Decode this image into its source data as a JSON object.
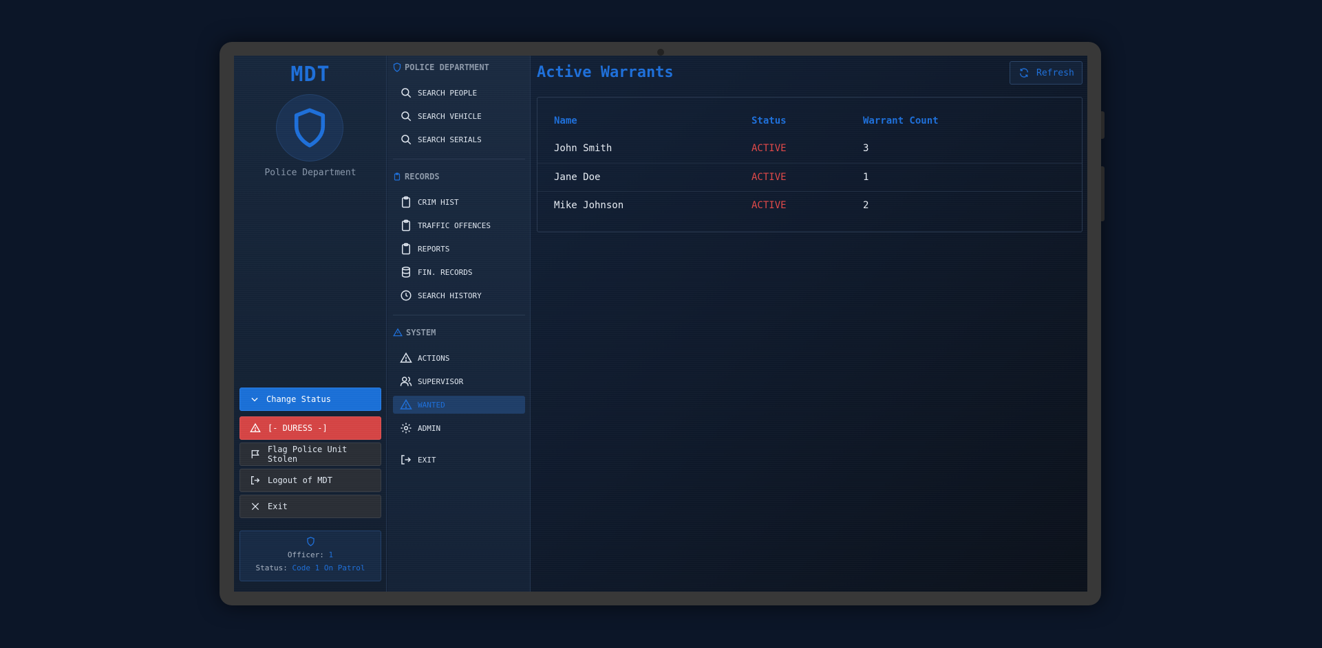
{
  "left_panel": {
    "app_title": "MDT",
    "department_name": "Police Department",
    "buttons": {
      "change_status": "Change Status",
      "duress": "[- DURESS -]",
      "flag_stolen": "Flag Police Unit Stolen",
      "logout": "Logout of MDT",
      "exit": "Exit"
    },
    "officer": {
      "officer_label": "Officer:",
      "officer_value": "1",
      "status_label": "Status:",
      "status_value": "Code 1 On Patrol"
    }
  },
  "nav": {
    "sections": [
      {
        "title": "POLICE DEPARTMENT",
        "icon": "shield-icon"
      },
      {
        "title": "RECORDS",
        "icon": "clipboard-icon"
      },
      {
        "title": "SYSTEM",
        "icon": "warning-icon"
      }
    ],
    "items": [
      {
        "label": "SEARCH PEOPLE",
        "icon": "search-icon"
      },
      {
        "label": "SEARCH VEHICLE",
        "icon": "search-icon"
      },
      {
        "label": "SEARCH SERIALS",
        "icon": "search-icon"
      },
      {
        "label": "CRIM HIST",
        "icon": "clipboard-icon"
      },
      {
        "label": "TRAFFIC OFFENCES",
        "icon": "clipboard-icon"
      },
      {
        "label": "REPORTS",
        "icon": "clipboard-icon"
      },
      {
        "label": "FIN. RECORDS",
        "icon": "database-icon"
      },
      {
        "label": "SEARCH HISTORY",
        "icon": "clock-icon"
      },
      {
        "label": "ACTIONS",
        "icon": "warning-icon"
      },
      {
        "label": "SUPERVISOR",
        "icon": "users-icon"
      },
      {
        "label": "WANTED",
        "icon": "warning-icon",
        "active": true
      },
      {
        "label": "ADMIN",
        "icon": "gear-icon"
      },
      {
        "label": "EXIT",
        "icon": "logout-icon"
      }
    ]
  },
  "main": {
    "title": "Active Warrants",
    "refresh_label": "Refresh",
    "table": {
      "columns": [
        "Name",
        "Status",
        "Warrant Count"
      ],
      "rows": [
        [
          "John Smith",
          "ACTIVE",
          "3"
        ],
        [
          "Jane Doe",
          "ACTIVE",
          "1"
        ],
        [
          "Mike Johnson",
          "ACTIVE",
          "2"
        ]
      ]
    }
  },
  "colors": {
    "accent": "#1e6fd9",
    "danger": "#d44444",
    "status_active": "#e04848",
    "background": "#0c1628"
  }
}
